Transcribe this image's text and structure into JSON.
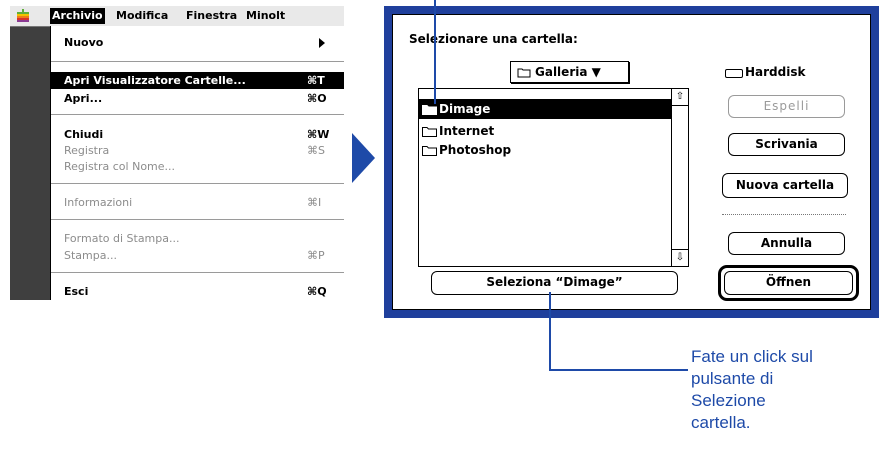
{
  "menubar": {
    "items": [
      "Archivio",
      "Modifica",
      "Finestra",
      "Minolt"
    ]
  },
  "menu": {
    "items": [
      {
        "label": "Nuovo",
        "shortcut": "",
        "submenu": true,
        "disabled": false,
        "highlight": false
      },
      {
        "label": "Apri Visualizzatore Cartelle...",
        "shortcut": "⌘T",
        "submenu": false,
        "disabled": false,
        "highlight": true
      },
      {
        "label": "Apri...",
        "shortcut": "⌘O",
        "submenu": false,
        "disabled": false,
        "highlight": false
      },
      {
        "label": "Chiudi",
        "shortcut": "⌘W",
        "submenu": false,
        "disabled": false,
        "highlight": false
      },
      {
        "label": "Registra",
        "shortcut": "⌘S",
        "submenu": false,
        "disabled": true,
        "highlight": false
      },
      {
        "label": "Registra col Nome...",
        "shortcut": "",
        "submenu": false,
        "disabled": true,
        "highlight": false
      },
      {
        "label": "Informazioni",
        "shortcut": "⌘I",
        "submenu": false,
        "disabled": true,
        "highlight": false
      },
      {
        "label": "Formato di Stampa...",
        "shortcut": "",
        "submenu": false,
        "disabled": true,
        "highlight": false
      },
      {
        "label": "Stampa...",
        "shortcut": "⌘P",
        "submenu": false,
        "disabled": true,
        "highlight": false
      },
      {
        "label": "Esci",
        "shortcut": "⌘Q",
        "submenu": false,
        "disabled": false,
        "highlight": false
      }
    ]
  },
  "dialog": {
    "prompt": "Selezionare una cartella:",
    "folder_popup": "Galleria ▼",
    "disk_name": "Harddisk",
    "files": [
      {
        "name": "Dimage",
        "selected": true
      },
      {
        "name": "Internet",
        "selected": false
      },
      {
        "name": "Photoshop",
        "selected": false
      }
    ],
    "buttons": {
      "eject": "Espelli",
      "desktop": "Scrivania",
      "new_folder": "Nuova cartella",
      "cancel": "Annulla",
      "open": "Öffnen",
      "select": "Seleziona “Dimage”"
    }
  },
  "callout": {
    "lines": [
      "Fate un click sul",
      "pulsante di",
      "Selezione",
      "cartella."
    ]
  },
  "colors": {
    "accent": "#1e4aa8",
    "dialog_frame": "#1f3f9c",
    "menu_background": "#3f3f3f"
  }
}
